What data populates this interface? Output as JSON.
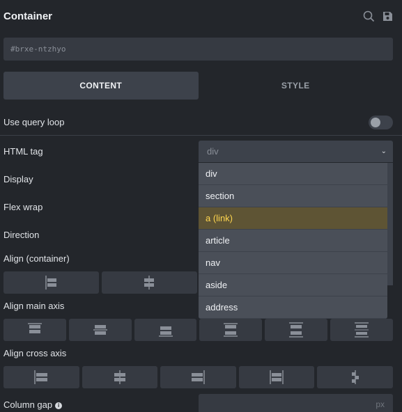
{
  "header": {
    "title": "Container",
    "icons": [
      "search-icon",
      "save-icon"
    ]
  },
  "element_id": {
    "value": "#brxe-ntzhyo"
  },
  "tabs": [
    {
      "label": "CONTENT",
      "active": true
    },
    {
      "label": "STYLE",
      "active": false
    }
  ],
  "fields": {
    "query_loop": {
      "label": "Use query loop",
      "enabled": false
    },
    "html_tag": {
      "label": "HTML tag",
      "value": "div"
    },
    "display": {
      "label": "Display"
    },
    "flex_wrap": {
      "label": "Flex wrap"
    },
    "direction": {
      "label": "Direction"
    },
    "align_container": {
      "label": "Align (container)"
    },
    "align_main_axis": {
      "label": "Align main axis"
    },
    "align_cross_axis": {
      "label": "Align cross axis"
    },
    "column_gap": {
      "label": "Column gap",
      "unit": "px"
    }
  },
  "dropdown": {
    "options": [
      "div",
      "section",
      "a (link)",
      "article",
      "nav",
      "aside",
      "address"
    ],
    "highlighted": "a (link)"
  },
  "colors": {
    "background": "#23262b",
    "field": "#363a42",
    "highlight_bg": "#5e5434",
    "highlight_text": "#ffd64f"
  }
}
